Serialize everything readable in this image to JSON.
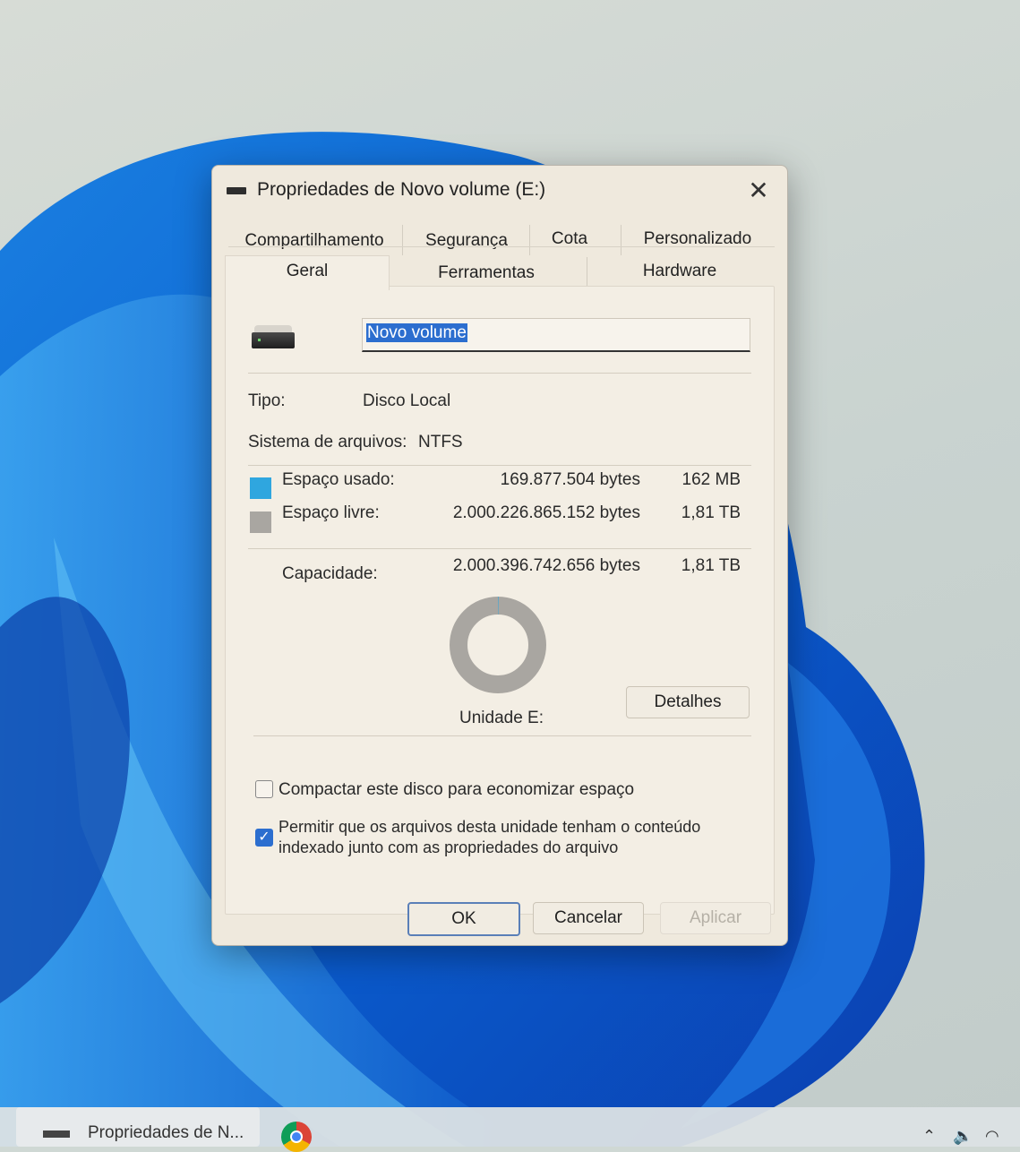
{
  "dialog": {
    "title": "Propriedades de Novo volume (E:)",
    "close_glyph": "✕",
    "tabs_row1": [
      "Compartilhamento",
      "Segurança",
      "Cota",
      "Personalizado"
    ],
    "tabs_row2": [
      "Geral",
      "Ferramentas",
      "Hardware"
    ],
    "active_tab": "Geral",
    "volume_name": "Novo volume",
    "type_label": "Tipo:",
    "type_value": "Disco Local",
    "fs_label": "Sistema de arquivos:",
    "fs_value": "NTFS",
    "used": {
      "label": "Espaço usado:",
      "bytes": "169.877.504 bytes",
      "size": "162 MB",
      "color": "#2fa6df"
    },
    "free": {
      "label": "Espaço livre:",
      "bytes": "2.000.226.865.152 bytes",
      "size": "1,81 TB",
      "color": "#a9a6a1"
    },
    "capacity": {
      "label": "Capacidade:",
      "bytes": "2.000.396.742.656 bytes",
      "size": "1,81 TB"
    },
    "used_fraction": 0.0001,
    "drive_label": "Unidade E:",
    "details_button": "Detalhes",
    "compress_label": "Compactar este disco para economizar espaço",
    "compress_checked": false,
    "index_label_line1": "Permitir que os arquivos desta unidade tenham o conteúdo",
    "index_label_line2": "indexado junto com as propriedades do arquivo",
    "index_checked": true,
    "buttons": {
      "ok": "OK",
      "cancel": "Cancelar",
      "apply": "Aplicar"
    }
  },
  "taskbar": {
    "active_window_label": "Propriedades de N...",
    "apps": [
      "chrome-icon"
    ]
  }
}
